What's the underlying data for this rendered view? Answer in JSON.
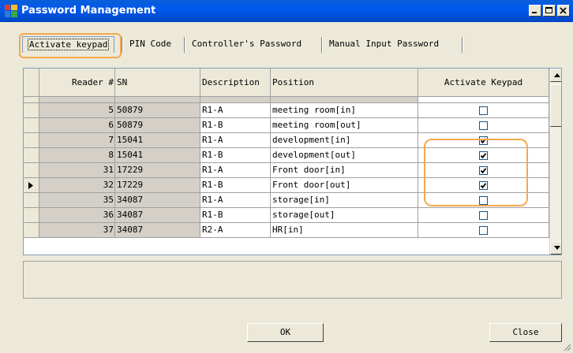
{
  "window": {
    "title": "Password Management"
  },
  "tabs": [
    {
      "label": "Activate keypad",
      "active": true
    },
    {
      "label": "PIN Code",
      "active": false
    },
    {
      "label": "Controller's Password",
      "active": false
    },
    {
      "label": "Manual Input Password",
      "active": false
    }
  ],
  "grid": {
    "columns": [
      "Reader #",
      "SN",
      "Description",
      "Position",
      "Activate Keypad"
    ],
    "rows": [
      {
        "reader": "5",
        "sn": "50879",
        "desc": "R1-A",
        "pos": "meeting room[in]",
        "checked": false,
        "current": false
      },
      {
        "reader": "6",
        "sn": "50879",
        "desc": "R1-B",
        "pos": "meeting room[out]",
        "checked": false,
        "current": false
      },
      {
        "reader": "7",
        "sn": "15041",
        "desc": "R1-A",
        "pos": "development[in]",
        "checked": true,
        "current": false
      },
      {
        "reader": "8",
        "sn": "15041",
        "desc": "R1-B",
        "pos": "development[out]",
        "checked": true,
        "current": false
      },
      {
        "reader": "31",
        "sn": "17229",
        "desc": "R1-A",
        "pos": "Front door[in]",
        "checked": true,
        "current": false
      },
      {
        "reader": "32",
        "sn": "17229",
        "desc": "R1-B",
        "pos": "Front door[out]",
        "checked": true,
        "current": true
      },
      {
        "reader": "35",
        "sn": "34087",
        "desc": "R1-A",
        "pos": "storage[in]",
        "checked": false,
        "current": false
      },
      {
        "reader": "36",
        "sn": "34087",
        "desc": "R1-B",
        "pos": "storage[out]",
        "checked": false,
        "current": false
      },
      {
        "reader": "37",
        "sn": "34087",
        "desc": "R2-A",
        "pos": "HR[in]",
        "checked": false,
        "current": false
      }
    ]
  },
  "buttons": {
    "ok": "OK",
    "close": "Close"
  },
  "colors": {
    "titlebar": "#0058ee",
    "highlight": "#f4a94e",
    "face": "#ece9d8",
    "cell_gray": "#d4d0c8"
  }
}
